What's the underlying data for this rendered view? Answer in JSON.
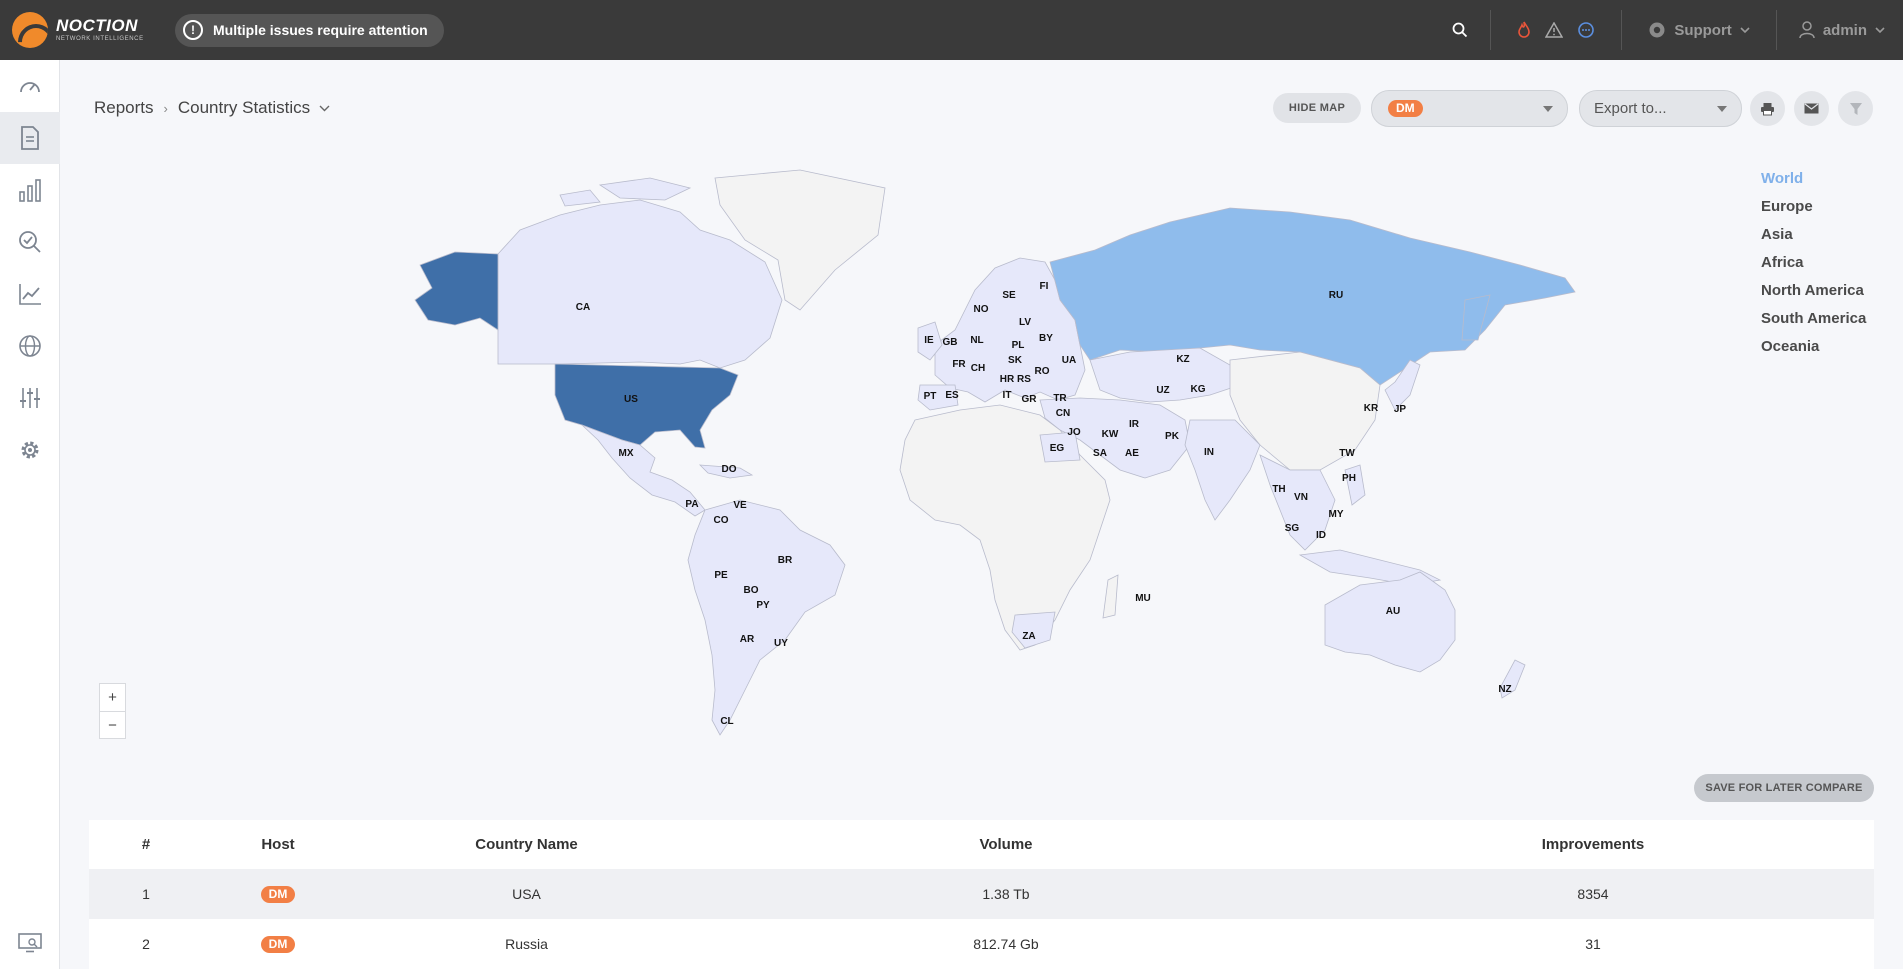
{
  "brand": {
    "name": "NOCTION",
    "tagline": "NETWORK INTELLIGENCE",
    "accent": "#f08a2b"
  },
  "alert": {
    "text": "Multiple issues require attention"
  },
  "topnav": {
    "support_label": "Support",
    "user_label": "admin"
  },
  "breadcrumb": {
    "root": "Reports",
    "current": "Country Statistics"
  },
  "toolbar": {
    "hide_map_label": "HIDE MAP",
    "host_value": "DM",
    "export_placeholder": "Export to..."
  },
  "regions": [
    "World",
    "Europe",
    "Asia",
    "Africa",
    "North America",
    "South America",
    "Oceania"
  ],
  "map": {
    "labels": [
      "CA",
      "US",
      "MX",
      "DO",
      "PA",
      "VE",
      "CO",
      "BR",
      "PE",
      "BO",
      "PY",
      "AR",
      "UY",
      "CL",
      "IE",
      "GB",
      "NL",
      "NO",
      "SE",
      "FI",
      "LV",
      "BY",
      "PL",
      "FR",
      "CH",
      "SK",
      "RO",
      "UA",
      "HR",
      "RS",
      "PT",
      "ES",
      "IT",
      "GR",
      "TR",
      "CN",
      "JO",
      "KW",
      "IR",
      "EG",
      "SA",
      "AE",
      "PK",
      "IN",
      "KZ",
      "UZ",
      "KG",
      "RU",
      "KR",
      "JP",
      "TW",
      "PH",
      "TH",
      "VN",
      "MY",
      "SG",
      "ID",
      "AU",
      "NZ",
      "ZA",
      "MU"
    ],
    "colors": {
      "high": "#3f6fa8",
      "mid": "#8fbcec",
      "low": "#e6e8fa",
      "none": "#f3f3f3"
    }
  },
  "zoom": {
    "in": "+",
    "out": "−"
  },
  "save_label": "SAVE FOR LATER COMPARE",
  "table": {
    "headers": [
      "#",
      "Host",
      "Country Name",
      "Volume",
      "Improvements"
    ],
    "rows": [
      {
        "index": "1",
        "host": "DM",
        "country": "USA",
        "volume": "1.38 Tb",
        "improvements": "8354"
      },
      {
        "index": "2",
        "host": "DM",
        "country": "Russia",
        "volume": "812.74 Gb",
        "improvements": "31"
      }
    ]
  }
}
